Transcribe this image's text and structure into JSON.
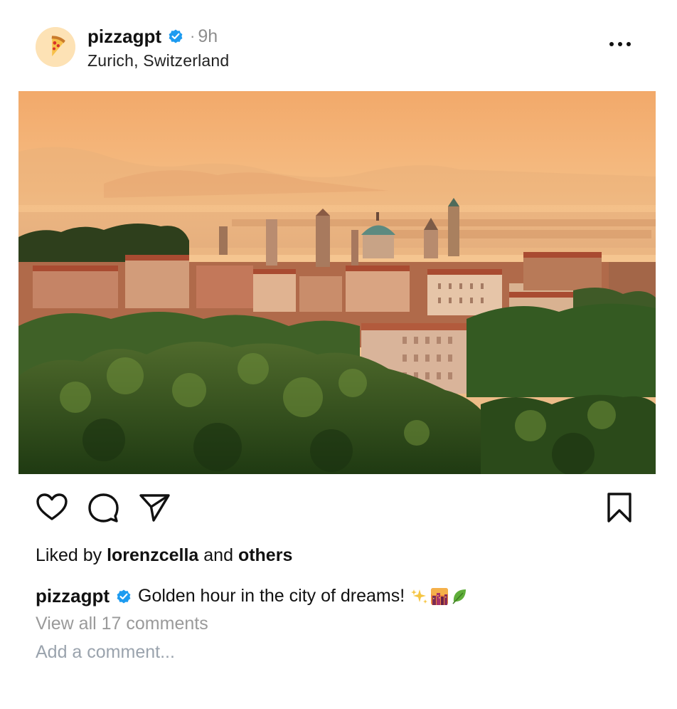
{
  "post": {
    "username": "pizzagpt",
    "separator": "·",
    "time": "9h",
    "location": "Zurich, Switzerland",
    "avatar_icon": "pizza-slice-icon",
    "verified_color": "#1d9bf0"
  },
  "likes": {
    "prefix": "Liked by",
    "user": "lorenzcella",
    "conjunction": "and",
    "others": "others"
  },
  "caption": {
    "username": "pizzagpt",
    "text": "Golden hour in the city of dreams!",
    "emojis": [
      "sparkles",
      "city-sunset",
      "leaf"
    ]
  },
  "comments": {
    "view_all": "View all 17 comments",
    "add_placeholder": "Add a comment..."
  },
  "icons": {
    "like": "heart-icon",
    "comment": "comment-bubble-icon",
    "share": "send-paper-plane-icon",
    "save": "bookmark-icon",
    "more": "more-horizontal-icon"
  }
}
